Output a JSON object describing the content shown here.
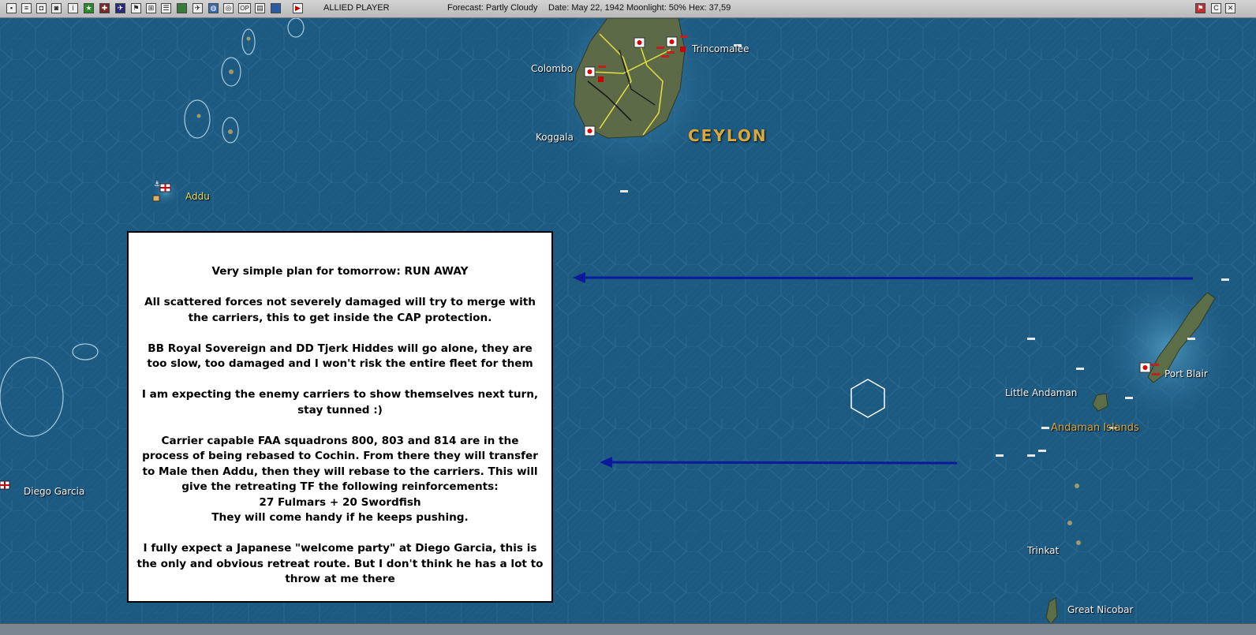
{
  "toolbar": {
    "player": "ALLIED PLAYER",
    "forecast": "Forecast: Partly Cloudy",
    "date": "Date: May 22, 1942",
    "moonlight": "Moonlight: 50%",
    "hex": "Hex: 37,59",
    "buttons": [
      "map",
      "report",
      "ships",
      "subs",
      "intel",
      "bases",
      "air",
      "ground",
      "flags",
      "group",
      "list",
      "display",
      "planes",
      "globe",
      "review",
      "op",
      "sheets",
      "screen",
      "end-turn"
    ],
    "right_buttons": [
      "allied-flag",
      "cancel",
      "exit"
    ]
  },
  "map": {
    "region_labels": {
      "ceylon": "CEYLON"
    },
    "places": {
      "colombo": "Colombo",
      "trincomalee": "Trincomalee",
      "koggala": "Koggala",
      "addu": "Addu",
      "diego_garcia": "Diego Garcia",
      "little_andaman": "Little Andaman",
      "port_blair": "Port Blair",
      "andaman_islands": "Andaman Islands",
      "trinkat": "Trinkat",
      "great_nicobar": "Great Nicobar"
    },
    "colors": {
      "sea": "#1d5a82",
      "arrow": "#0b1a9c",
      "land": "#4a5a40",
      "road": "#e6e040"
    }
  },
  "note": {
    "paragraphs": [
      "Very simple plan for tomorrow: RUN AWAY",
      "All scattered forces not severely damaged will try to merge with the carriers, this to get inside the CAP protection.",
      "BB Royal Sovereign and DD Tjerk Hiddes will go alone, they are too slow, too damaged and I won't risk the entire fleet for them",
      "I am expecting the enemy carriers to show themselves next turn, stay tunned :)",
      "Carrier capable FAA squadrons 800, 803 and 814 are in the process of being rebased to Cochin. From there they will transfer to Male then Addu, then they will rebase to the carriers. This will give the retreating TF the following reinforcements:",
      "27 Fulmars + 20 Swordfish",
      "They will come handy if he keeps pushing.",
      "I fully expect a Japanese \"welcome party\" at Diego Garcia, this is the only and obvious retreat route. But I don't think he has a lot to throw at me there"
    ]
  }
}
